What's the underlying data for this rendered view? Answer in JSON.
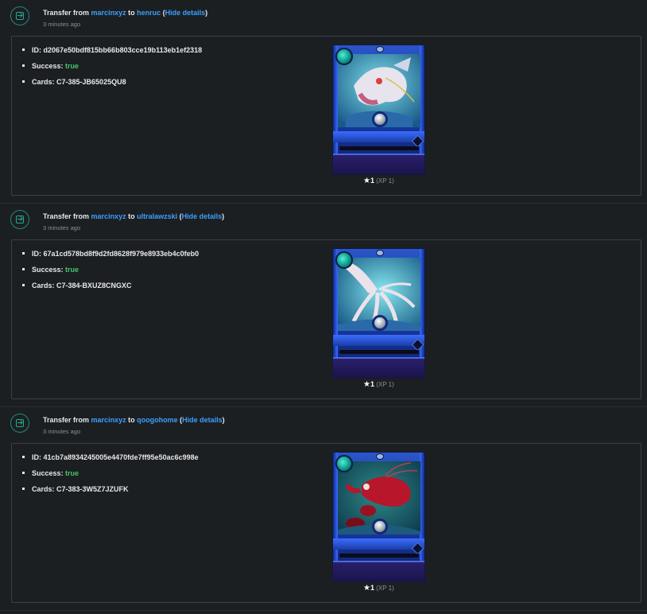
{
  "entries": [
    {
      "prefix": "Transfer from",
      "from": "marcinxyz",
      "to_word": "to",
      "to": "henruc",
      "open_paren": "(",
      "toggle": "Hide details",
      "close_paren": ")",
      "time": "3 minutes ago",
      "id_label": "ID:",
      "id": "d2067e50bdf815bb66b803cce19b113eb1ef2318",
      "success_label": "Success:",
      "success": "true",
      "cards_label": "Cards:",
      "cards": "C7-385-JB65025QU8",
      "level": "1",
      "xp": "(XP 1)",
      "art": "water-dragon-art"
    },
    {
      "prefix": "Transfer from",
      "from": "marcinxyz",
      "to_word": "to",
      "to": "ultralawzski",
      "open_paren": "(",
      "toggle": "Hide details",
      "close_paren": ")",
      "time": "3 minutes ago",
      "id_label": "ID:",
      "id": "67a1cd578bd8f9d2fd8628f979e8933eb4c0feb0",
      "success_label": "Success:",
      "success": "true",
      "cards_label": "Cards:",
      "cards": "C7-384-BXUZ8CNGXC",
      "level": "1",
      "xp": "(XP 1)",
      "art": "squid-art"
    },
    {
      "prefix": "Transfer from",
      "from": "marcinxyz",
      "to_word": "to",
      "to": "qoogohome",
      "open_paren": "(",
      "toggle": "Hide details",
      "close_paren": ")",
      "time": "3 minutes ago",
      "id_label": "ID:",
      "id": "41cb7a8934245005e4470fde7ff95e50ac6c998e",
      "success_label": "Success:",
      "success": "true",
      "cards_label": "Cards:",
      "cards": "C7-383-3W5Z7JZUFK",
      "level": "1",
      "xp": "(XP 1)",
      "art": "crustacean-art"
    }
  ],
  "colors": {
    "background": "#1c1f22",
    "link": "#3aa0ff",
    "success": "#49c36c",
    "icon_accent": "#26a893"
  },
  "icons": {
    "entry": "transfer-in-icon",
    "star": "star-icon"
  }
}
